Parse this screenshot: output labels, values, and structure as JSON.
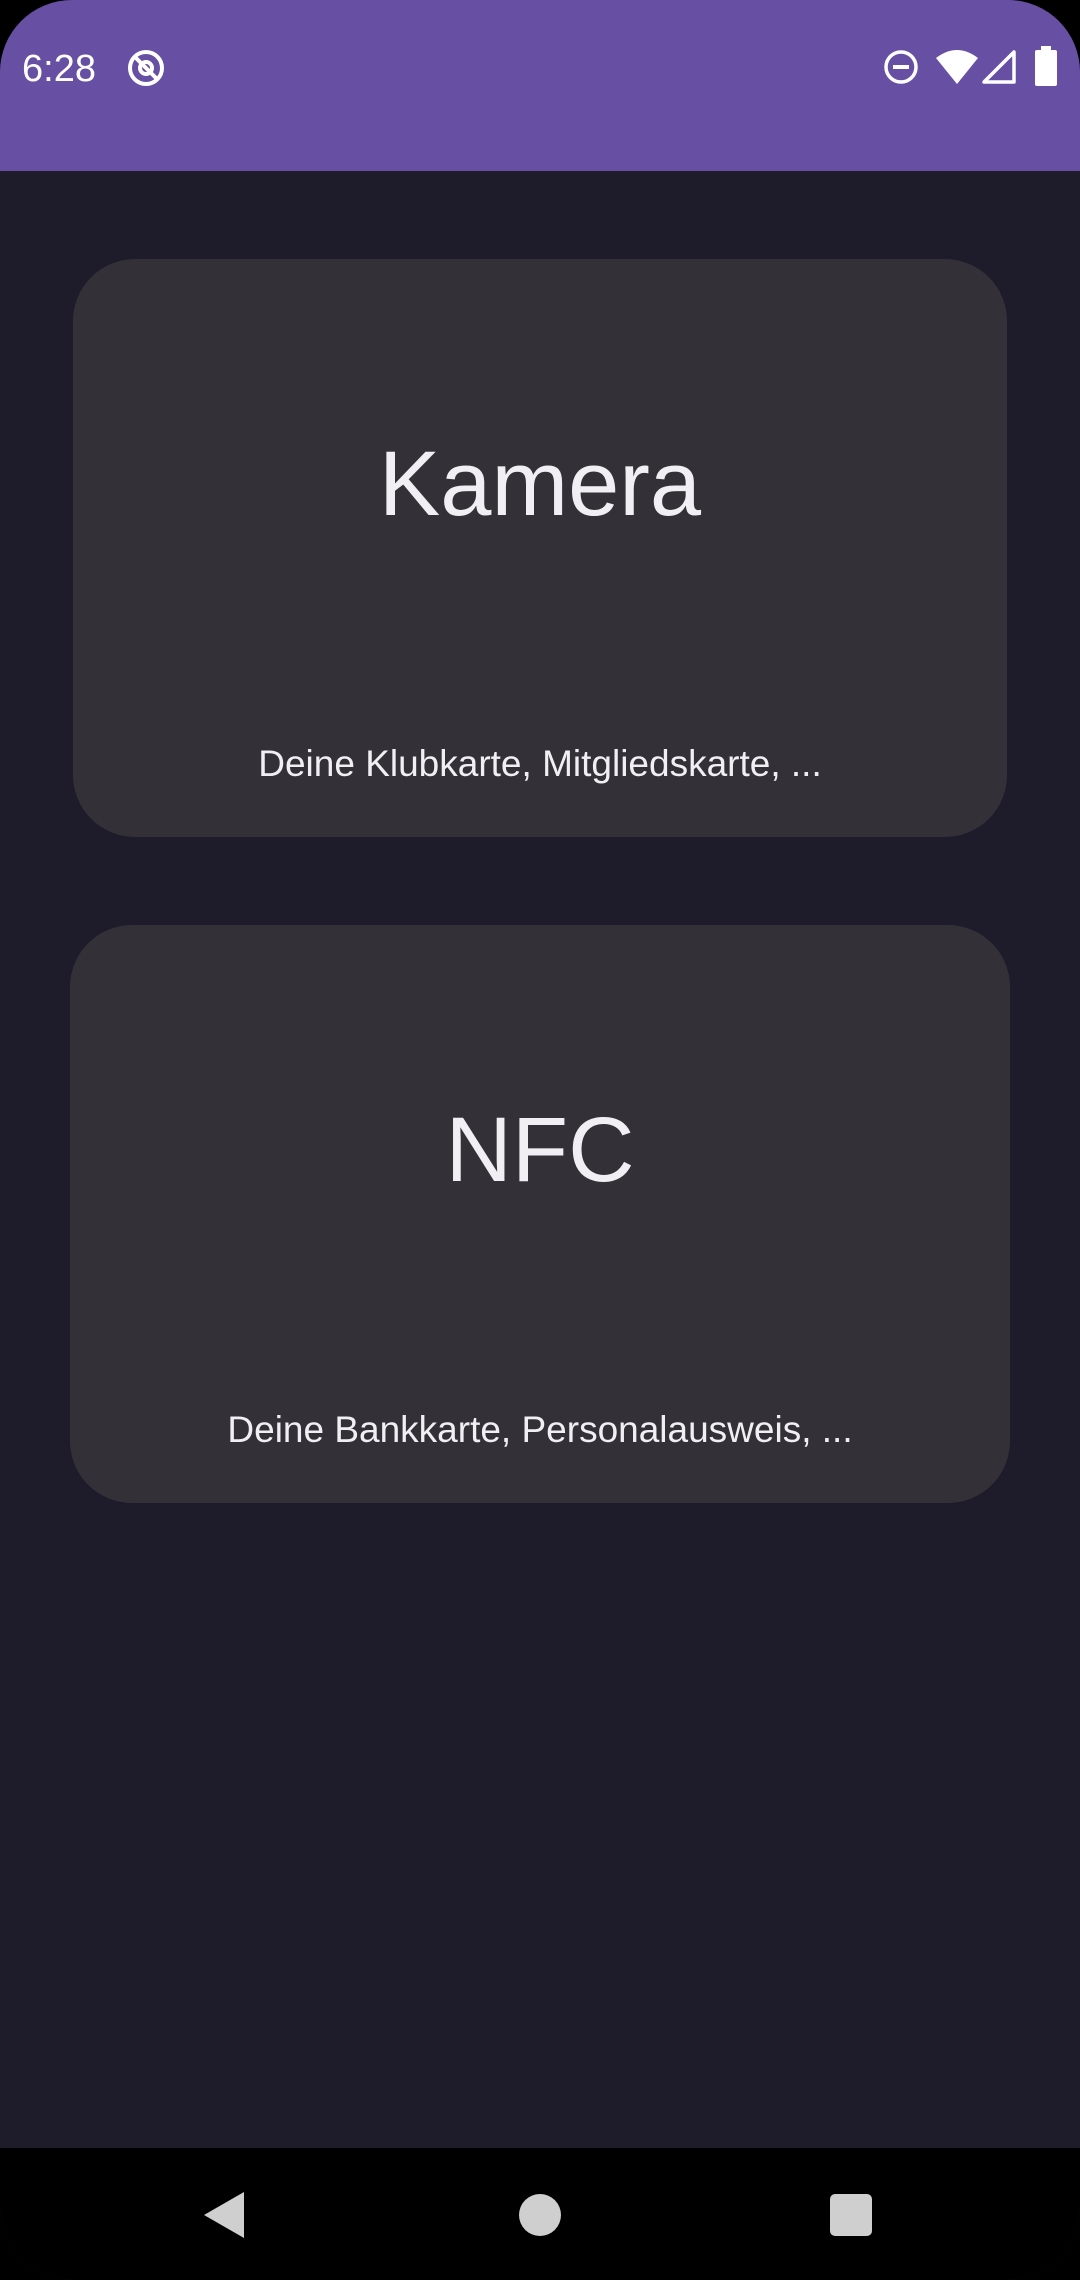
{
  "status_bar": {
    "time": "6:28",
    "background_color": "#6750a4",
    "icons": [
      "at-sign-icon",
      "do-not-disturb-icon",
      "wifi-icon",
      "cellular-signal-icon",
      "battery-icon"
    ]
  },
  "main": {
    "background_color": "#1e1b2b",
    "cards": [
      {
        "title": "Kamera",
        "subtitle": "Deine Klubkarte, Mitgliedskarte, ..."
      },
      {
        "title": "NFC",
        "subtitle": "Deine Bankkarte, Personalausweis, ..."
      }
    ],
    "card_color": "#333137"
  },
  "navigation_bar": {
    "buttons": [
      "back-icon",
      "home-icon",
      "recents-icon"
    ]
  }
}
